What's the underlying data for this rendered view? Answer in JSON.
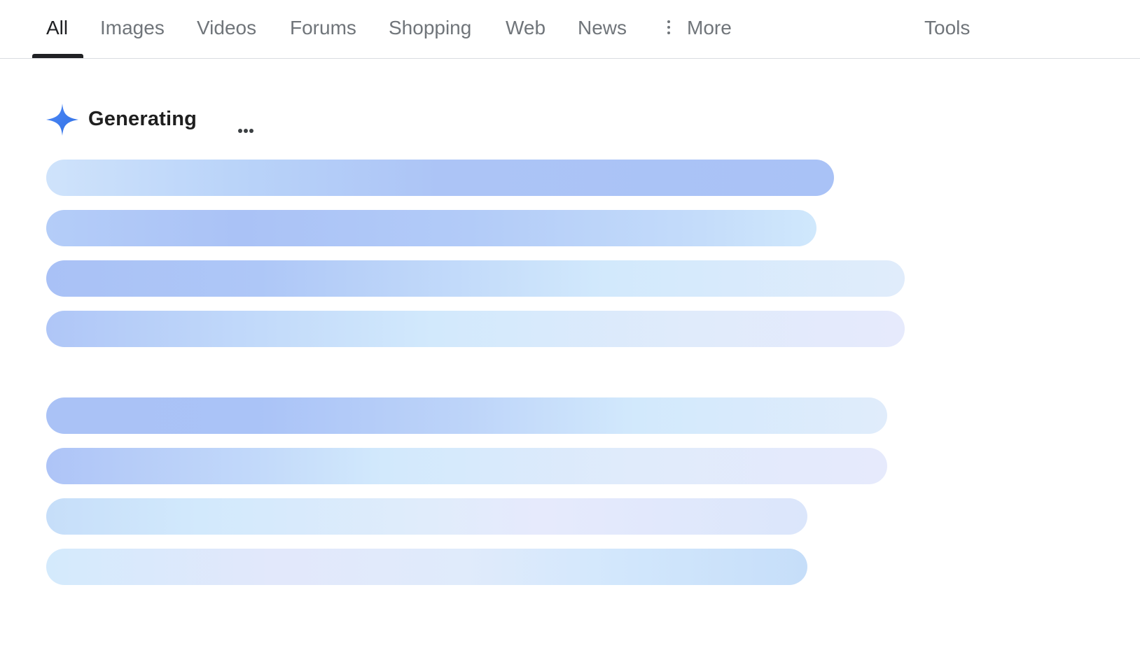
{
  "tabs": [
    {
      "label": "All",
      "active": true
    },
    {
      "label": "Images",
      "active": false
    },
    {
      "label": "Videos",
      "active": false
    },
    {
      "label": "Forums",
      "active": false
    },
    {
      "label": "Shopping",
      "active": false
    },
    {
      "label": "Web",
      "active": false
    },
    {
      "label": "News",
      "active": false
    }
  ],
  "more": {
    "label": "More",
    "icon": "more-vert-icon"
  },
  "tools": {
    "label": "Tools"
  },
  "ai_overview": {
    "status": "Generating",
    "icon": "sparkle-icon",
    "accent": "#4285f4",
    "placeholder_line_count": 8
  },
  "colors": {
    "active_text": "#202124",
    "inactive_text": "#70757a",
    "divider": "#dadce0",
    "shimmer_blue": "#a8c1f7",
    "shimmer_light": "#cfe8fc",
    "shimmer_lavender": "#e6eafc"
  }
}
